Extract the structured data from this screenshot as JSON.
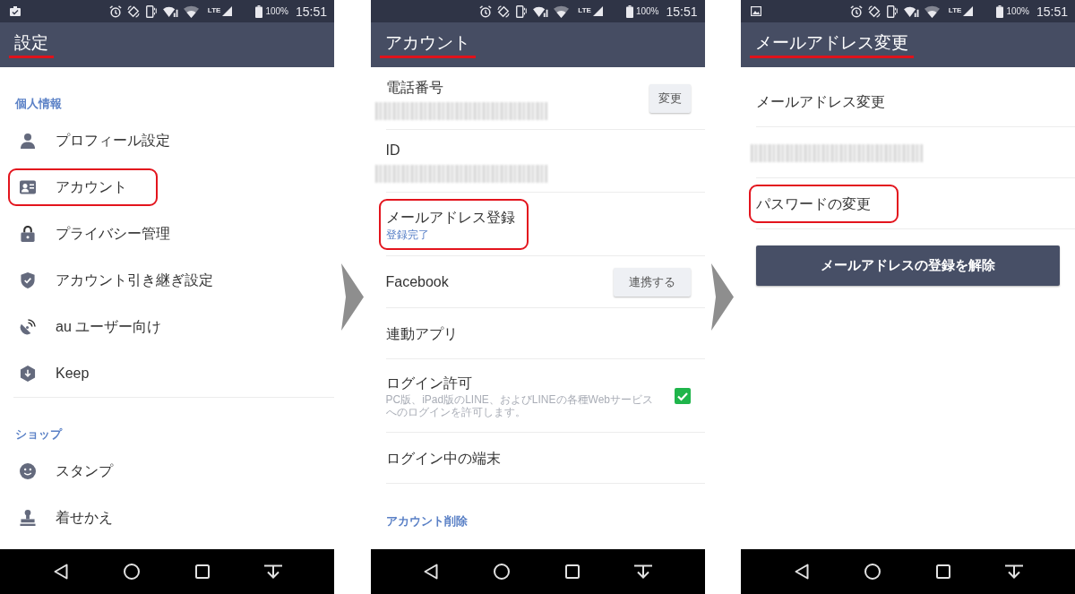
{
  "screens": [
    {
      "kind": "menu",
      "status_bar": {
        "notification": {
          "kind": "task"
        },
        "network": "LTE",
        "battery": "100%",
        "time": "15:51"
      },
      "title": {
        "text": "設定",
        "underlined": true
      },
      "sections": [
        {
          "heading": "個人情報",
          "items": [
            {
              "label": "プロフィール設定",
              "highlighted": false
            },
            {
              "label": "アカウント",
              "highlighted": true
            },
            {
              "label": "プライバシー管理",
              "highlighted": false
            },
            {
              "label": "アカウント引き継ぎ設定",
              "highlighted": false
            },
            {
              "label": "au ユーザー向け",
              "highlighted": false
            },
            {
              "label": "Keep",
              "highlighted": false
            }
          ]
        },
        {
          "heading": "ショップ",
          "items": [
            {
              "label": "スタンプ",
              "highlighted": false
            },
            {
              "label": "着せかえ",
              "highlighted": false
            }
          ]
        }
      ]
    },
    {
      "kind": "detail",
      "status_bar": {
        "network": "LTE",
        "battery": "100%",
        "time": "15:51"
      },
      "title": {
        "text": "アカウント",
        "underlined": true
      },
      "rows": [
        {
          "kind": "value",
          "label": "電話番号",
          "redacted": true,
          "button": "変更",
          "highlighted": false
        },
        {
          "kind": "value",
          "label": "ID",
          "redacted": true,
          "highlighted": false
        },
        {
          "kind": "status",
          "label": "メールアドレス登録",
          "status": "登録完了",
          "highlighted": true
        },
        {
          "kind": "action",
          "label": "Facebook",
          "button": "連携する",
          "highlighted": false
        },
        {
          "kind": "plain",
          "label": "連動アプリ",
          "highlighted": false
        },
        {
          "kind": "toggle",
          "label": "ログイン許可",
          "description": "PC版、iPad版のLINE、およびLINEの各種Webサービスへのログインを許可します。",
          "checked": true,
          "highlighted": false
        },
        {
          "kind": "plain",
          "label": "ログイン中の端末",
          "highlighted": false
        }
      ],
      "footer_link": "アカウント削除"
    },
    {
      "kind": "detail",
      "status_bar": {
        "notification": {
          "kind": "image"
        },
        "network": "LTE",
        "battery": "100%",
        "time": "15:51"
      },
      "title": {
        "text": "メールアドレス変更",
        "underlined": true
      },
      "rows": [
        {
          "kind": "plain",
          "label": "メールアドレス変更",
          "highlighted": false
        },
        {
          "kind": "redacted",
          "redacted": true,
          "highlighted": false
        },
        {
          "kind": "plain",
          "label": "パスワードの変更",
          "highlighted": true
        }
      ],
      "button": "メールアドレスの登録を解除"
    }
  ]
}
